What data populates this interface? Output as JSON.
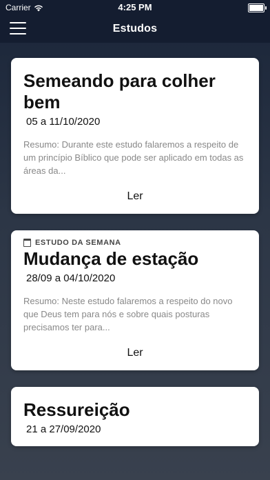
{
  "status_bar": {
    "carrier": "Carrier",
    "time": "4:25 PM"
  },
  "nav": {
    "title": "Estudos"
  },
  "cards": [
    {
      "badge": "",
      "title": "Semeando para colher bem",
      "date": "05 a 11/10/2020",
      "summary": "Resumo: Durante este estudo falaremos a respeito de um princípio Bíblico que pode ser aplicado em todas as áreas da...",
      "read_label": "Ler"
    },
    {
      "badge": "ESTUDO DA SEMANA",
      "title": "Mudança de estação",
      "date": "28/09 a 04/10/2020",
      "summary": "Resumo: Neste estudo falaremos a respeito do novo que Deus tem para nós e sobre quais posturas precisamos ter para...",
      "read_label": "Ler"
    },
    {
      "badge": "",
      "title": "Ressureição",
      "date": "21 a 27/09/2020",
      "summary": "",
      "read_label": ""
    }
  ]
}
